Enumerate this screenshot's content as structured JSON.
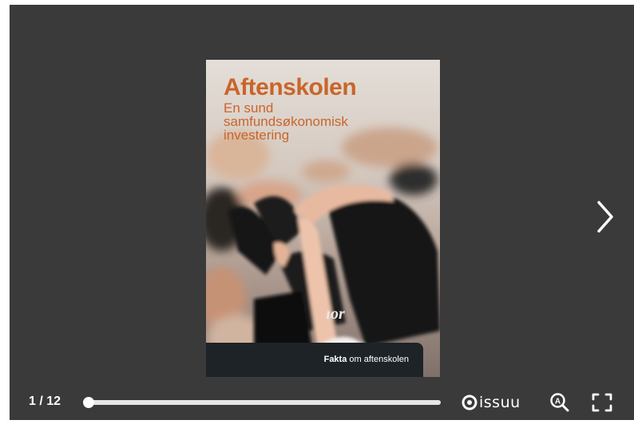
{
  "cover": {
    "title": "Aftenskolen",
    "subtitle": "En sund samfundsøkonomisk investering",
    "footer_bold": "Fakta",
    "footer_text": " om aftenskolen"
  },
  "navigation": {
    "next_icon": "chevron-right-icon"
  },
  "controls": {
    "page_counter": "1 / 12",
    "progress": 0.0,
    "logo_text": "issuu",
    "zoom_icon": "zoom-icon",
    "fullscreen_icon": "fullscreen-icon"
  },
  "colors": {
    "viewer_bg": "#3a3a3a",
    "title_color": "#c9652a",
    "footer_bg": "#1e2328",
    "controls_fg": "#ffffff"
  }
}
